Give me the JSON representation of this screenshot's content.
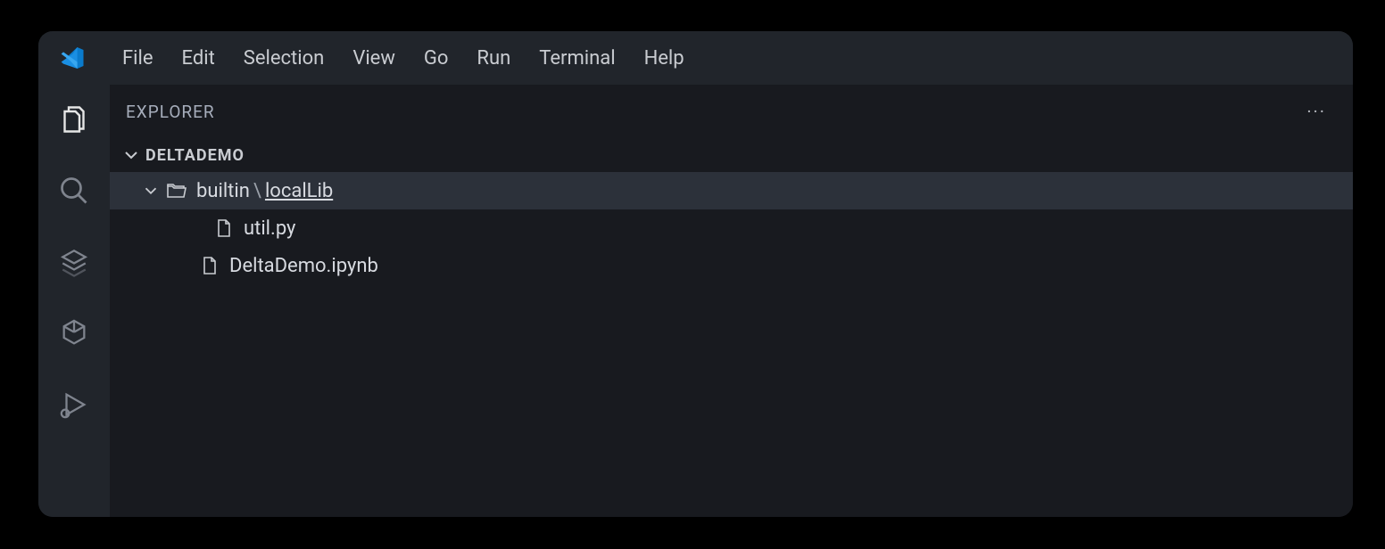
{
  "menu": {
    "file": "File",
    "edit": "Edit",
    "selection": "Selection",
    "view": "View",
    "go": "Go",
    "run": "Run",
    "terminal": "Terminal",
    "help": "Help"
  },
  "sidebar": {
    "title": "EXPLORER",
    "section_label": "DELTADEMO"
  },
  "tree": {
    "folder_prefix": "builtin",
    "folder_separator": "\\",
    "folder_name": "localLib",
    "file_util": "util.py",
    "file_notebook": "DeltaDemo.ipynb"
  },
  "more": "···"
}
